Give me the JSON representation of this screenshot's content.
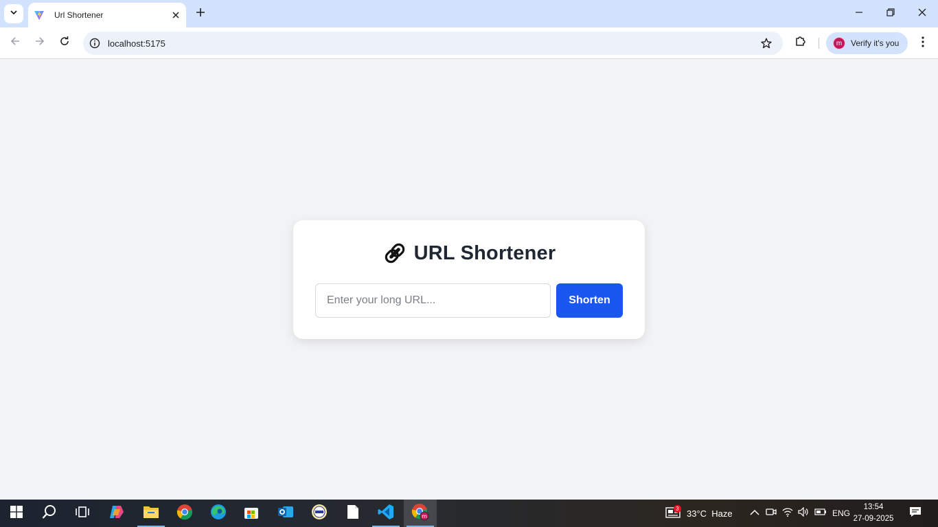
{
  "browser": {
    "tab": {
      "title": "Url Shortener"
    },
    "address_bar": {
      "url": "localhost:5175"
    },
    "profile": {
      "initial": "m",
      "label": "Verify it's you"
    }
  },
  "page": {
    "title": "URL Shortener",
    "icon": "link-icon",
    "input": {
      "placeholder": "Enter your long URL...",
      "value": ""
    },
    "button_label": "Shorten"
  },
  "taskbar": {
    "pinned": [
      "start-icon",
      "search-icon",
      "task-view-icon",
      "copilot-icon",
      "file-explorer-icon",
      "chrome-icon",
      "edge-icon",
      "store-icon",
      "outlook-icon",
      "app-icon",
      "notepad-icon",
      "vscode-icon",
      "chrome-profile-icon"
    ],
    "news_badge": "3",
    "weather": "33°C  Haze",
    "language": "ENG",
    "time": "13:54",
    "date": "27-09-2025"
  },
  "colors": {
    "accent": "#1a56f0",
    "tabstrip": "#d3e3fd",
    "page_bg": "#f2f3f5"
  }
}
